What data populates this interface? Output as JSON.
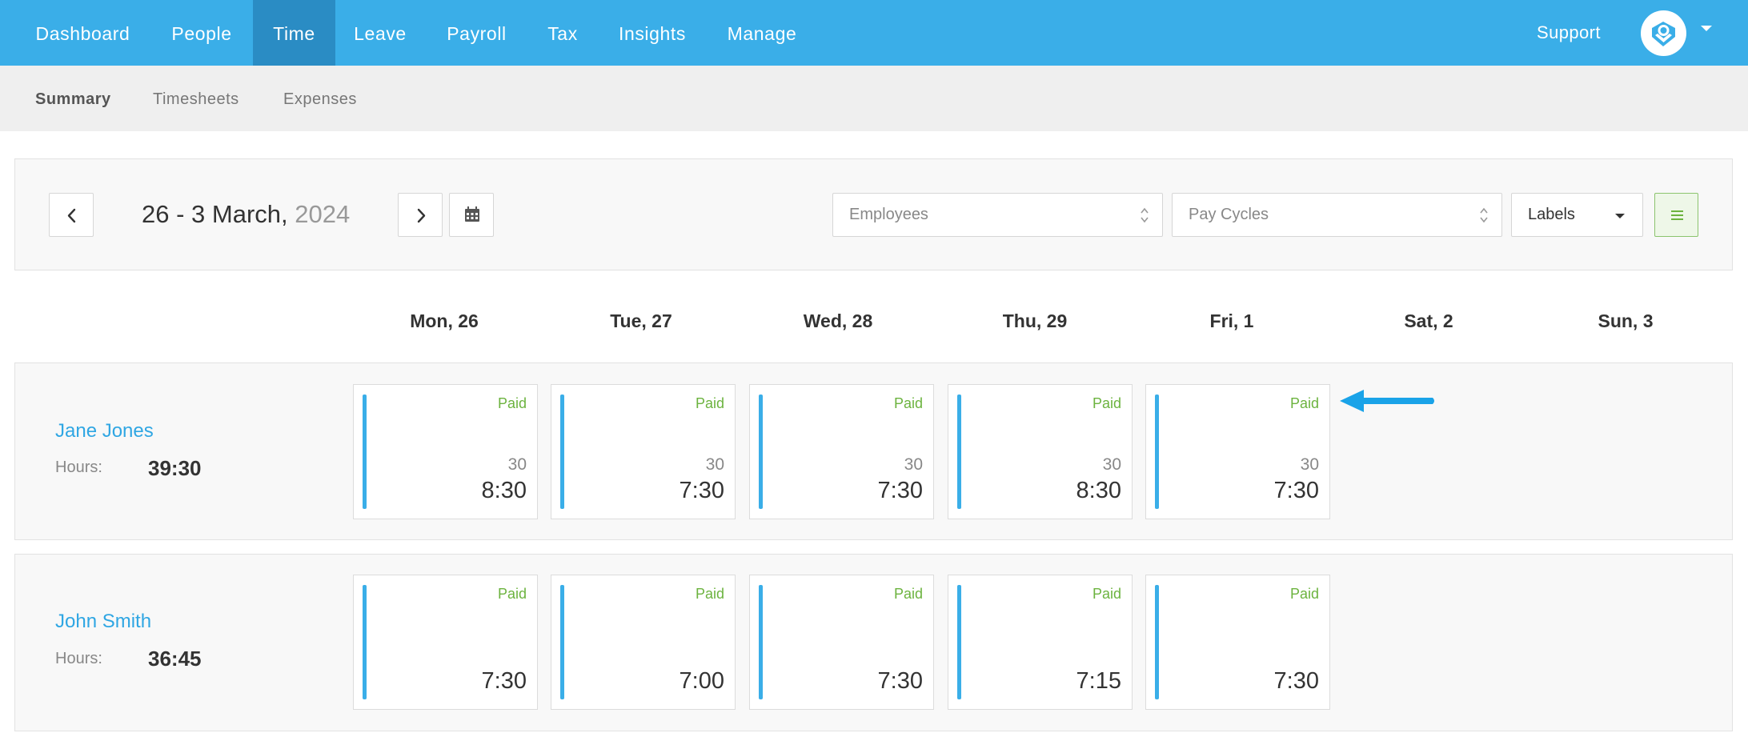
{
  "nav": {
    "items": [
      {
        "label": "Dashboard"
      },
      {
        "label": "People"
      },
      {
        "label": "Time"
      },
      {
        "label": "Leave"
      },
      {
        "label": "Payroll"
      },
      {
        "label": "Tax"
      },
      {
        "label": "Insights"
      },
      {
        "label": "Manage"
      }
    ],
    "active": "Time",
    "support_label": "Support",
    "accent_color": "#3aaee8",
    "active_color": "#2a8cc4"
  },
  "subnav": {
    "items": [
      {
        "label": "Summary"
      },
      {
        "label": "Timesheets"
      },
      {
        "label": "Expenses"
      }
    ],
    "active": "Summary"
  },
  "toolbar": {
    "prev_icon": "chevron-left-icon",
    "next_icon": "chevron-right-icon",
    "calendar_icon": "calendar-icon",
    "date_range": "26 - 3 March,",
    "year": "2024",
    "employees_placeholder": "Employees",
    "pay_cycles_placeholder": "Pay Cycles",
    "labels_value": "Labels",
    "list_view_icon": "list-icon",
    "list_view_color": "#6cb33f"
  },
  "days": [
    "Mon, 26",
    "Tue, 27",
    "Wed, 28",
    "Thu, 29",
    "Fri, 1",
    "Sat, 2",
    "Sun, 3"
  ],
  "hours_label": "Hours:",
  "employees": [
    {
      "name": "Jane Jones",
      "hours": "39:30",
      "entries": [
        {
          "status": "Paid",
          "break": "30",
          "total": "8:30"
        },
        {
          "status": "Paid",
          "break": "30",
          "total": "7:30"
        },
        {
          "status": "Paid",
          "break": "30",
          "total": "7:30"
        },
        {
          "status": "Paid",
          "break": "30",
          "total": "8:30"
        },
        {
          "status": "Paid",
          "break": "30",
          "total": "7:30"
        }
      ]
    },
    {
      "name": "John Smith",
      "hours": "36:45",
      "entries": [
        {
          "status": "Paid",
          "break": "",
          "total": "7:30"
        },
        {
          "status": "Paid",
          "break": "",
          "total": "7:00"
        },
        {
          "status": "Paid",
          "break": "",
          "total": "7:30"
        },
        {
          "status": "Paid",
          "break": "",
          "total": "7:15"
        },
        {
          "status": "Paid",
          "break": "",
          "total": "7:30"
        }
      ]
    }
  ],
  "status_color": "#6cb33f",
  "annotation_arrow_color": "#1aa3e8"
}
